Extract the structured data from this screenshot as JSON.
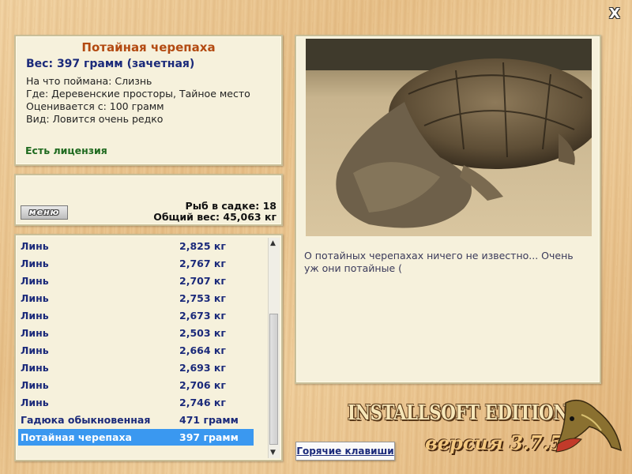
{
  "window": {
    "close_label": "X"
  },
  "fish": {
    "title": "Потайная черепаха",
    "weight": "Вес: 397 грамм (зачетная)",
    "caught_on": "На что поймана: Слизнь",
    "where": "Где: Деревенские просторы, Тайное место",
    "valued_from": "Оценивается с: 100 грамм",
    "kind": "Вид: Ловится очень редко",
    "license": "Есть лицензия"
  },
  "summary": {
    "menu_label": "меню",
    "fish_in_net": "Рыб в садке: 18",
    "total_weight": "Общий вес: 45,063 кг"
  },
  "catch_list": [
    {
      "name": "Линь",
      "weight": "2,825 кг"
    },
    {
      "name": "Линь",
      "weight": "2,767 кг"
    },
    {
      "name": "Линь",
      "weight": "2,707 кг"
    },
    {
      "name": "Линь",
      "weight": "2,753 кг"
    },
    {
      "name": "Линь",
      "weight": "2,673 кг"
    },
    {
      "name": "Линь",
      "weight": "2,503 кг"
    },
    {
      "name": "Линь",
      "weight": "2,664 кг"
    },
    {
      "name": "Линь",
      "weight": "2,693 кг"
    },
    {
      "name": "Линь",
      "weight": "2,706 кг"
    },
    {
      "name": "Линь",
      "weight": "2,746 кг"
    },
    {
      "name": "Гадюка обыкновенная",
      "weight": "471 грамм"
    },
    {
      "name": "Потайная черепаха",
      "weight": "397 грамм",
      "selected": true
    }
  ],
  "description": "О потайных черепахах ничего не известно... Очень уж они потайные (",
  "hotkeys_label": "Горячие клавиши",
  "brand": {
    "edition": "INSTALLSOFT EDITION",
    "version": "версия 3.7.5"
  },
  "colors": {
    "title": "#b34a11",
    "value": "#1b2a7a",
    "license": "#1f6a1f",
    "selection": "#3a98f0"
  }
}
